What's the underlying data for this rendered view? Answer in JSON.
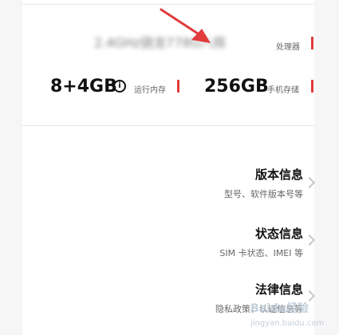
{
  "processor": {
    "value": "2.4GHz骁龙778G八核",
    "label": "处理器"
  },
  "memory": {
    "ram_value": "8+4GB",
    "ram_info_glyph": "i",
    "ram_label": "运行内存",
    "rom_value": "256GB",
    "rom_label": "手机存储"
  },
  "menu": {
    "items": [
      {
        "title": "版本信息",
        "subtitle": "型号、软件版本号等"
      },
      {
        "title": "状态信息",
        "subtitle": "SIM 卡状态、IMEI 等"
      },
      {
        "title": "法律信息",
        "subtitle": "隐私政策、认证信息等"
      }
    ]
  },
  "watermark": {
    "main": "Baidu经验",
    "sub": "jingyan.baidu.com"
  },
  "colors": {
    "accent_red": "#e23b3b",
    "chevron": "#c8c8c8",
    "muted_text": "#666666"
  },
  "icons": [
    "annotation-arrow-icon",
    "info-circle-icon",
    "chevron-right-icon",
    "red-marker-bar"
  ]
}
